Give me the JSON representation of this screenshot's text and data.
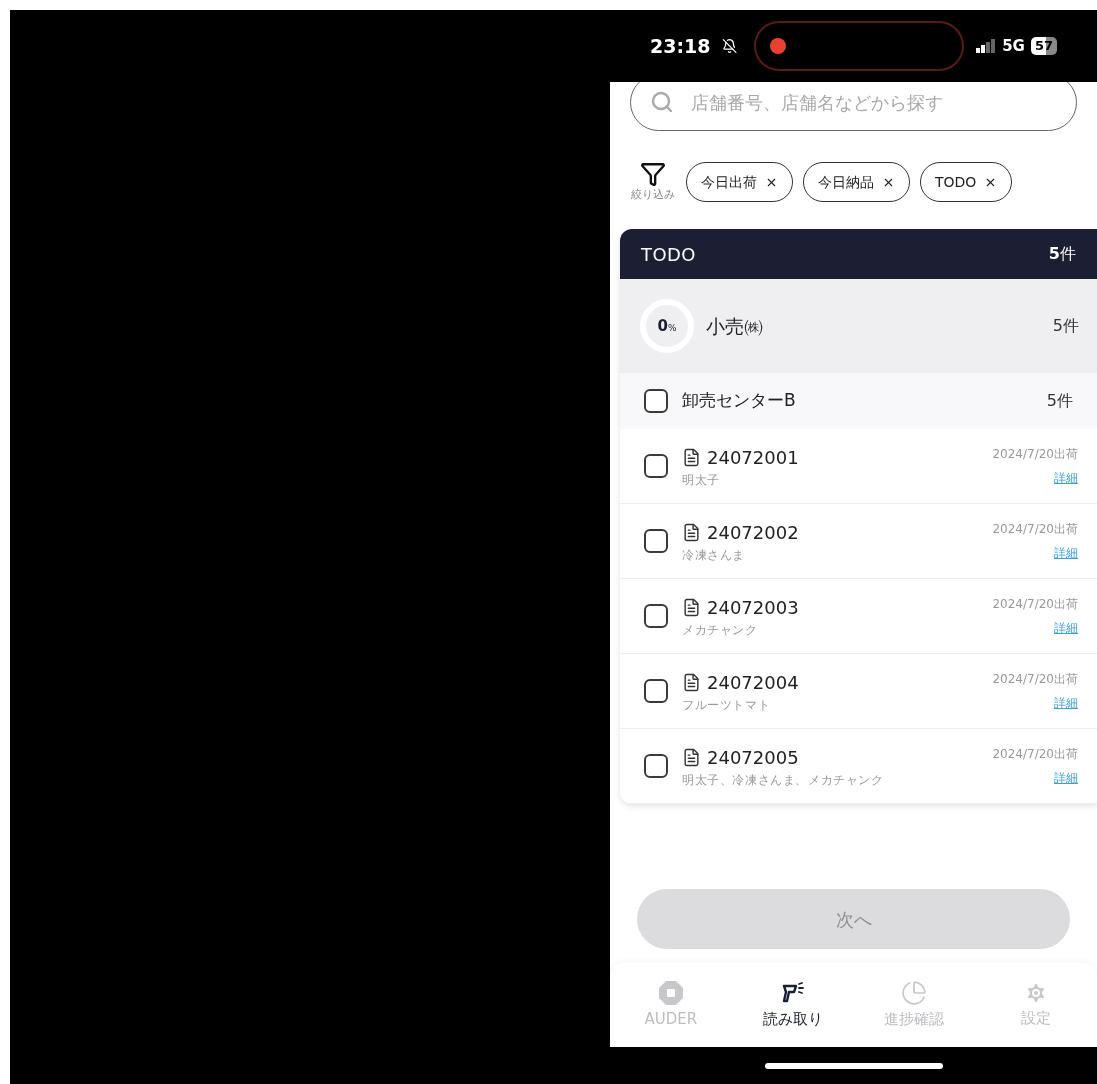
{
  "status_bar": {
    "time": "23:18",
    "network": "5G",
    "battery": "57"
  },
  "search": {
    "placeholder": "店舗番号、店舗名などから探す"
  },
  "filter": {
    "label": "絞り込み",
    "chips": [
      {
        "label": "今日出荷"
      },
      {
        "label": "今日納品"
      },
      {
        "label": "TODO"
      }
    ]
  },
  "section": {
    "title": "TODO",
    "count": "**5**件"
  },
  "group": {
    "percent": "0",
    "percent_unit": "%",
    "level": 0,
    "name": "小売㈱",
    "count": "5件"
  },
  "center": {
    "name": "卸売センターB",
    "count": "5件",
    "checked": false
  },
  "orders": [
    {
      "number": "24072001",
      "items": "明太子",
      "date": "2024/7/20出荷",
      "link": "詳細",
      "checked": false
    },
    {
      "number": "24072002",
      "items": "冷凍さんま",
      "date": "2024/7/20出荷",
      "link": "詳細",
      "checked": false
    },
    {
      "number": "24072003",
      "items": "メカチャンク",
      "date": "2024/7/20出荷",
      "link": "詳細",
      "checked": false
    },
    {
      "number": "24072004",
      "items": "フルーツトマト",
      "date": "2024/7/20出荷",
      "link": "詳細",
      "checked": false
    },
    {
      "number": "24072005",
      "items": "明太子、冷凍さんま、メカチャンク",
      "date": "2024/7/20出荷",
      "link": "詳細",
      "checked": false
    }
  ],
  "next_button": {
    "label": "次へ",
    "disabled": true
  },
  "tabs": [
    {
      "kind": "auder",
      "label": "AUDER",
      "selected": false
    },
    {
      "kind": "scan",
      "label": "読み取り",
      "selected": true
    },
    {
      "kind": "progress",
      "label": "進捗確認",
      "selected": false
    },
    {
      "kind": "settings",
      "label": "設定",
      "selected": false
    }
  ]
}
